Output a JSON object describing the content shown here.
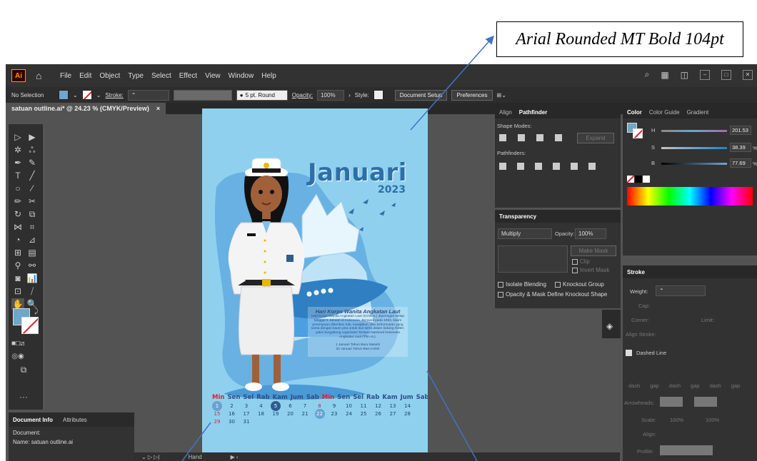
{
  "callout": {
    "text": "Arial Rounded MT Bold 104pt"
  },
  "menubar": {
    "logo": "Ai",
    "items": [
      "File",
      "Edit",
      "Object",
      "Type",
      "Select",
      "Effect",
      "View",
      "Window",
      "Help"
    ]
  },
  "control": {
    "selection": "No Selection",
    "stroke_label": "Stroke:",
    "brush": "5 pt. Round",
    "opacity_label": "Opacity:",
    "opacity": "100%",
    "style_label": "Style:",
    "doc_setup": "Document Setup",
    "prefs": "Preferences"
  },
  "doc_tab": {
    "title": "satuan outline.ai* @ 24.23 % (CMYK/Preview)",
    "close": "×"
  },
  "artboard": {
    "title": "Januari",
    "year": "2023",
    "info_heading": "Hari Korps Wanita Angkatan Laut",
    "info_body": "Hari Korps Wanita Angkatan Laut (KOWAL) diperingati setiap tanggal 5 Januari di Indonesia. Berawal pada 1963, kaum perempuan diberikan hak, kewajiban, dan kehormatan yang sama dengan kaum pria untuk ikut serta dalam bidang militer, yakni bergabung organisasi Tentara Nasional Indonesia Angkatan Laut (TNI-AL).",
    "info_note1": "1 Januari  Tahun Baru Masehi",
    "info_note2": "22 Januari Tahun Baru Imlek",
    "weekdays": [
      "Min",
      "Sen",
      "Sel",
      "Rab",
      "Kam",
      "Jum",
      "Sab",
      "Min",
      "Sen",
      "Sel",
      "Rab",
      "Kam",
      "Jum",
      "Sab"
    ],
    "dates": [
      "1",
      "2",
      "3",
      "4",
      "5",
      "6",
      "7",
      "8",
      "9",
      "10",
      "11",
      "12",
      "13",
      "14",
      "15",
      "16",
      "17",
      "18",
      "19",
      "20",
      "21",
      "22",
      "23",
      "24",
      "25",
      "26",
      "27",
      "28",
      "29",
      "30",
      "31"
    ]
  },
  "pathfinder": {
    "tabs": [
      "Align",
      "Pathfinder"
    ],
    "shape_modes": "Shape Modes:",
    "expand": "Expand",
    "pathfinders": "Pathfinders:"
  },
  "transparency": {
    "title": "Transparency",
    "mode": "Multiply",
    "opacity_label": "Opacity:",
    "opacity": "100%",
    "make_mask": "Make Mask",
    "clip": "Clip",
    "invert": "Invert Mask",
    "isolate": "Isolate Blending",
    "knockout": "Knockout Group",
    "opacity_mask": "Opacity & Mask Define Knockout Shape"
  },
  "color": {
    "tabs": [
      "Color",
      "Color Guide",
      "Gradient"
    ],
    "h_label": "H",
    "h": "201.53",
    "s_label": "S",
    "s": "38.39",
    "b_label": "B",
    "b": "77.69",
    "pct": "%",
    "deg": "°"
  },
  "stroke": {
    "title": "Stroke",
    "weight": "Weight:",
    "cap": "Cap:",
    "corner": "Corner:",
    "limit": "Limit:",
    "align": "Align Stroke:",
    "dashed": "Dashed Line",
    "dash_labels": [
      "dash",
      "gap",
      "dash",
      "gap",
      "dash",
      "gap"
    ],
    "arrowheads": "Arrowheads:",
    "scale": "Scale:",
    "scale1": "100%",
    "scale2": "100%",
    "align2": "Align:",
    "profile": "Profile:"
  },
  "docinfo": {
    "tabs": [
      "Document Info",
      "Attributes"
    ],
    "document": "Document:",
    "name": "Name: satuan outline.ai"
  },
  "status": {
    "tool": "Hand"
  },
  "colors": {
    "accent": "#6fa6c9",
    "title": "#2d6fa8",
    "red": "#e0202a"
  }
}
